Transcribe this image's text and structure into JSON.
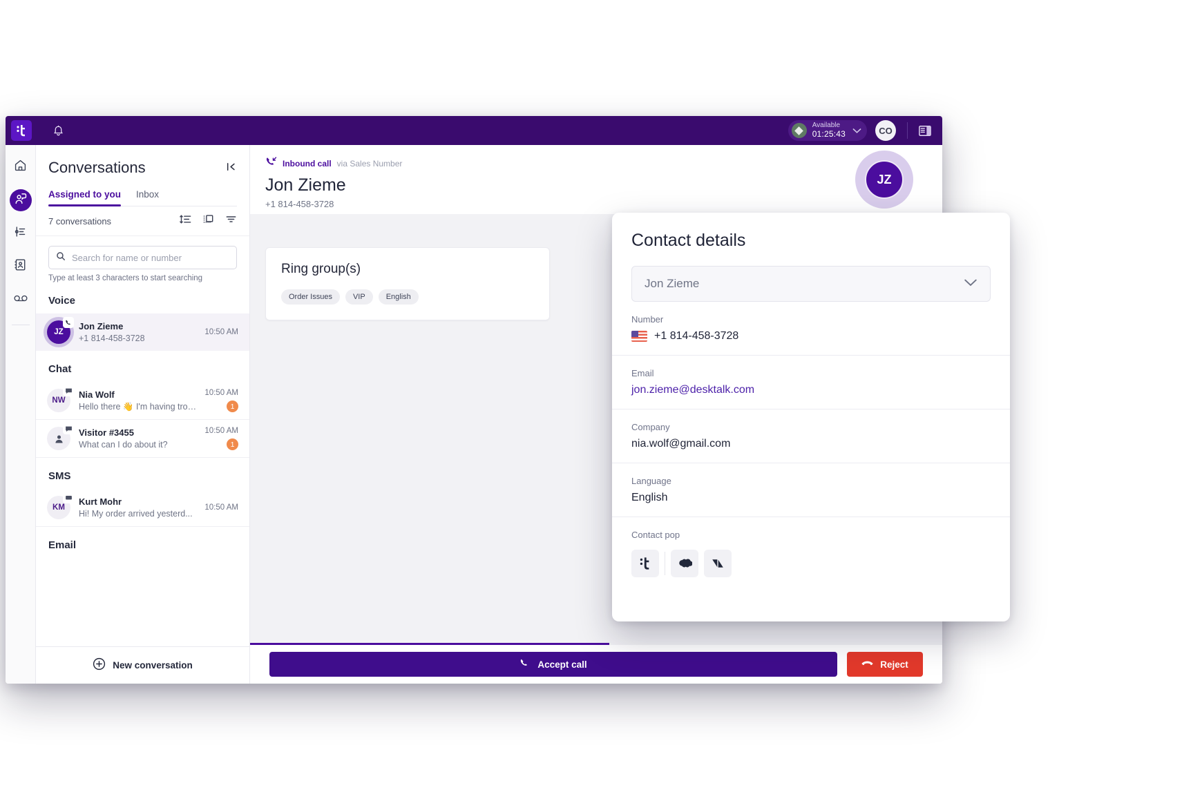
{
  "topbar": {
    "logo_icon": "talkdesk-logo-icon",
    "bell_icon": "notification-bell-icon",
    "status_label": "Available",
    "status_timer": "01:25:43",
    "status_icon": "diamond-status-icon",
    "chevron_icon": "chevron-down-icon",
    "user_initials": "CO",
    "panel_toggle_icon": "side-panel-toggle-icon",
    "bar_color": "#3a0b6e"
  },
  "rail": {
    "items": [
      {
        "name": "home",
        "icon": "home-icon",
        "active": false
      },
      {
        "name": "conversations",
        "icon": "agent-headset-icon",
        "active": true
      },
      {
        "name": "activity",
        "icon": "activity-list-icon",
        "active": false
      },
      {
        "name": "contacts",
        "icon": "contact-book-icon",
        "active": false
      },
      {
        "name": "voicemail",
        "icon": "voicemail-icon",
        "active": false
      }
    ],
    "accent_color": "#4b0d9e"
  },
  "conversations": {
    "title": "Conversations",
    "collapse_icon": "collapse-panel-icon",
    "tabs": [
      {
        "label": "Assigned to you",
        "active": true
      },
      {
        "label": "Inbox",
        "active": false
      }
    ],
    "count_text": "7 conversations",
    "toolbar_icons": [
      {
        "name": "sort-icon"
      },
      {
        "name": "group-view-icon"
      },
      {
        "name": "filter-icon"
      }
    ],
    "search": {
      "placeholder": "Search for name or number",
      "value": "",
      "icon": "search-icon",
      "hint": "Type at least 3 characters to start searching"
    },
    "groups": [
      {
        "label": "Voice",
        "items": [
          {
            "initials": "JZ",
            "avatar_style": "jz",
            "name": "Jon Zieme",
            "preview": "+1 814-458-3728",
            "time": "10:50 AM",
            "unread": "",
            "selected": true,
            "channel_icon": "phone-incoming-icon"
          }
        ]
      },
      {
        "label": "Chat",
        "items": [
          {
            "initials": "NW",
            "avatar_style": "nw",
            "name": "Nia Wolf",
            "preview": "Hello there 👋 I'm having trouble...",
            "time": "10:50 AM",
            "unread": "1",
            "selected": false,
            "channel_icon": "chat-bubble-icon"
          },
          {
            "initials": "",
            "avatar_style": "anon",
            "name": "Visitor #3455",
            "preview": "What can I do about it?",
            "time": "10:50 AM",
            "unread": "1",
            "selected": false,
            "channel_icon": "chat-bubble-icon"
          }
        ]
      },
      {
        "label": "SMS",
        "items": [
          {
            "initials": "KM",
            "avatar_style": "km",
            "name": "Kurt Mohr",
            "preview": "Hi! My order arrived yesterd...",
            "time": "10:50 AM",
            "unread": "",
            "selected": false,
            "channel_icon": "sms-bubble-icon"
          }
        ]
      },
      {
        "label": "Email",
        "items": []
      }
    ],
    "new_conversation": {
      "label": "New conversation",
      "icon": "plus-circle-icon"
    }
  },
  "call": {
    "direction_icon": "inbound-call-icon",
    "direction_label": "Inbound call",
    "via_label": "via Sales Number",
    "caller_name": "Jon Zieme",
    "caller_number": "+1 814-458-3728",
    "avatar_initials": "JZ",
    "ring_group": {
      "title": "Ring group(s)",
      "chips": [
        "Order Issues",
        "VIP",
        "English"
      ]
    },
    "actions": {
      "accept_label": "Accept call",
      "accept_icon": "phone-icon",
      "accept_color": "#3f0d8c",
      "reject_label": "Reject",
      "reject_icon": "phone-hangup-icon",
      "reject_color": "#e2392b"
    },
    "cursor_icon": "pointer-hand-cursor-icon"
  },
  "contact_details": {
    "title": "Contact details",
    "contact_select": {
      "value": "Jon Zieme",
      "chevron_icon": "chevron-down-icon"
    },
    "fields": [
      {
        "label": "Number",
        "value": "+1 814-458-3728",
        "type": "phone",
        "flag": "us-flag-icon"
      },
      {
        "label": "Email",
        "value": "jon.zieme@desktalk.com",
        "type": "link"
      },
      {
        "label": "Company",
        "value": "nia.wolf@gmail.com",
        "type": "text"
      },
      {
        "label": "Language",
        "value": "English",
        "type": "text"
      }
    ],
    "contact_pop": {
      "label": "Contact pop",
      "apps": [
        {
          "name": "talkdesk-app-icon"
        },
        {
          "name": "salesforce-app-icon"
        },
        {
          "name": "zendesk-app-icon"
        }
      ]
    }
  }
}
